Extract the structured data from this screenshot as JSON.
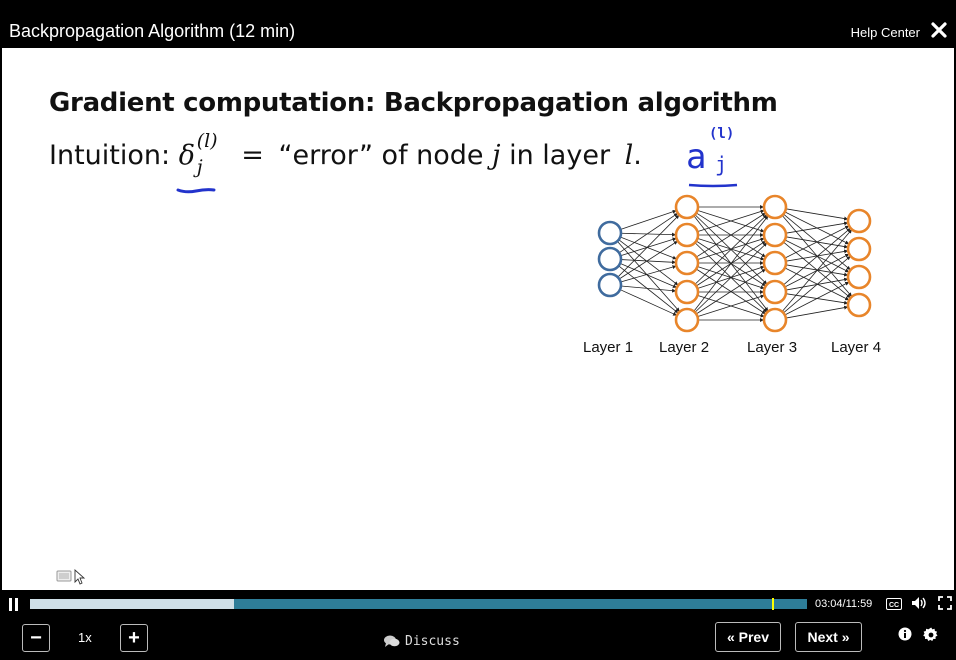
{
  "window": {
    "title": "Backpropagation Algorithm (12 min)",
    "help_label": "Help Center"
  },
  "slide": {
    "heading": "Gradient computation: Backpropagation algorithm",
    "intuition_label": "Intuition:",
    "delta_symbol": "δ",
    "delta_superscript": "(l)",
    "delta_subscript": "j",
    "equals": "=",
    "error_phrase": "“error” of node",
    "node_symbol": "j",
    "in_layer": "in layer",
    "layer_symbol": "l",
    "period": ".",
    "handwritten_symbol": "a",
    "handwritten_superscript": "(l)",
    "handwritten_subscript": "j",
    "network": {
      "layer_labels": [
        "Layer 1",
        "Layer 2",
        "Layer 3",
        "Layer 4"
      ],
      "layer_node_counts": [
        3,
        5,
        5,
        4
      ],
      "input_color": "#3f6b9e",
      "hidden_color": "#e8852a"
    }
  },
  "player": {
    "played_fraction": 0.2624,
    "marker_fraction": 0.955,
    "time_current": "03:04",
    "time_separator": "/",
    "time_total": "11:59",
    "cc_label": "CC",
    "speed": "1x",
    "decrease_label": "−",
    "increase_label": "+",
    "discuss_label": "Discuss",
    "prev_label": "« Prev",
    "next_label": "Next »",
    "accent": "#2e7d98"
  }
}
